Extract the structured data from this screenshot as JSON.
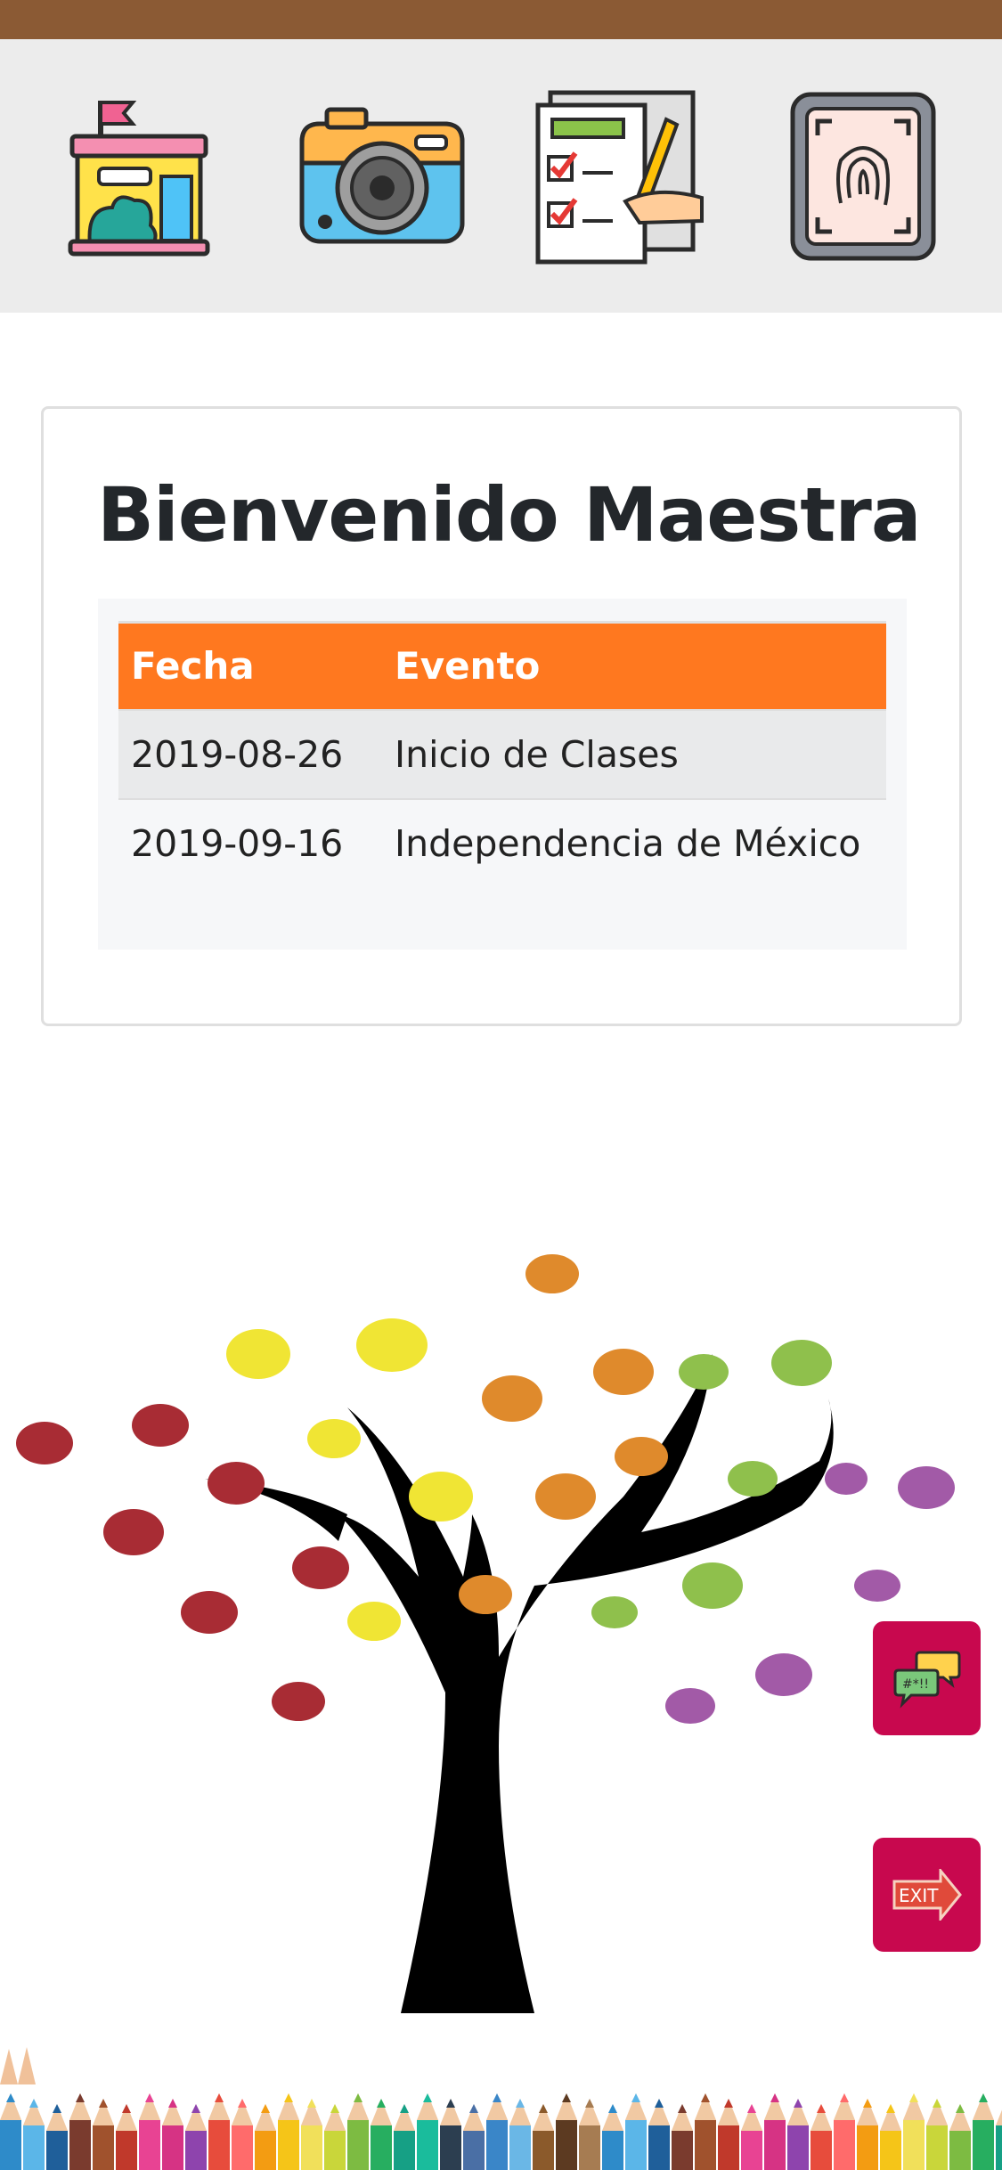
{
  "nav": {
    "items": [
      {
        "icon": "school-icon"
      },
      {
        "icon": "camera-icon"
      },
      {
        "icon": "checklist-icon"
      },
      {
        "icon": "fingerprint-icon"
      }
    ]
  },
  "welcome": {
    "title": "Bienvenido Maestra"
  },
  "events_table": {
    "headers": [
      "Fecha",
      "Evento"
    ],
    "rows": [
      [
        "2019-08-26",
        "Inicio de Clases"
      ],
      [
        "2019-09-16",
        "Independencia de México"
      ]
    ]
  },
  "floating": {
    "chat_icon": "chat-icon",
    "exit_icon": "exit-icon",
    "exit_label": "EXIT"
  },
  "colors": {
    "status_bar": "#8B5A34",
    "header_row": "#FF781F",
    "floating_button": "#C8084E"
  }
}
